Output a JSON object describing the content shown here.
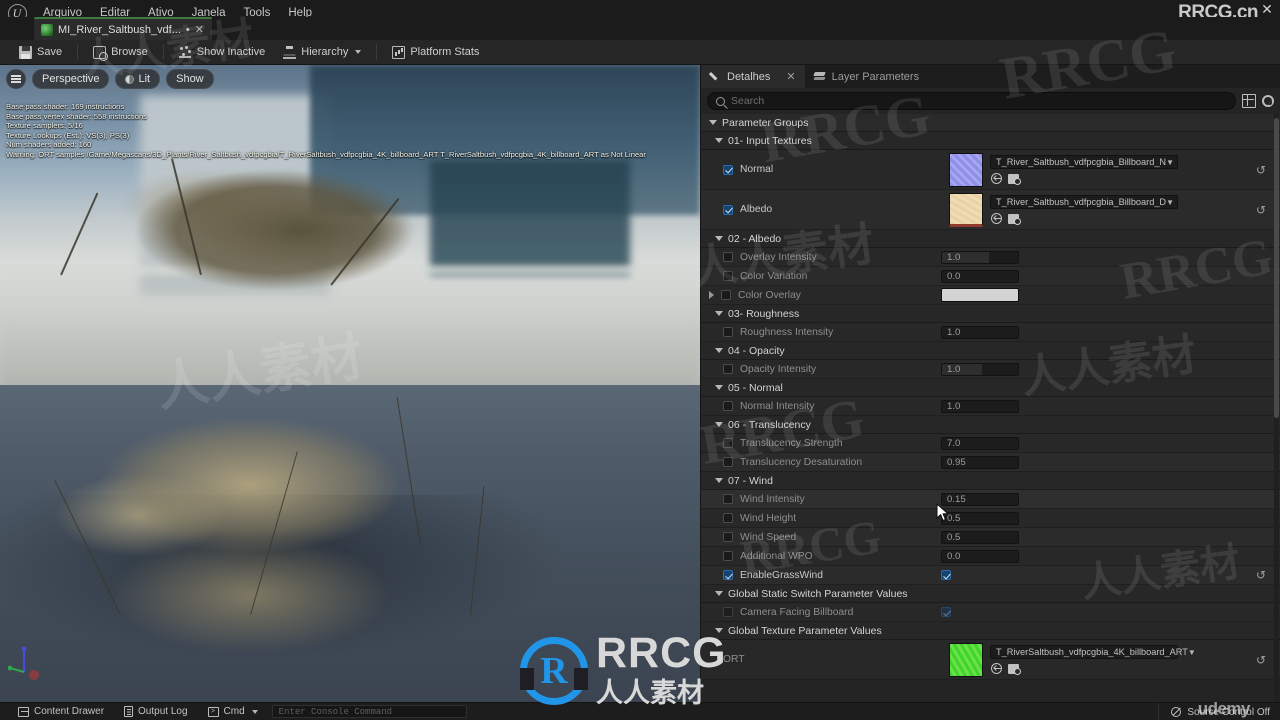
{
  "window": {
    "watermark_right": "RRCG.cn",
    "close_label": "✕"
  },
  "menubar": {
    "items": [
      "Arquivo",
      "Editar",
      "Ativo",
      "Janela",
      "Tools",
      "Help"
    ]
  },
  "tab": {
    "label": "MI_River_Saltbush_vdf...",
    "dirty_marker": "•",
    "close": "✕"
  },
  "toolbar": {
    "save": "Save",
    "browse": "Browse",
    "show_inactive": "Show Inactive",
    "hierarchy": "Hierarchy",
    "platform_stats": "Platform Stats"
  },
  "viewport": {
    "menu_icon": "hamburger-icon",
    "perspective": "Perspective",
    "lit": "Lit",
    "show": "Show",
    "stats": [
      "Base pass shader: 169 instructions",
      "Base pass vertex shader: 558 instructions",
      "Texture samplers: 5/16",
      "Texture Lookups (Est.): VS(3), PS(3)",
      "Num shaders added: 160",
      "Warning: ORT samples /Game/Megascans/3D_Plants/River_Saltbush_vdfpcgbia/T_RiverSaltbush_vdfpcgbia_4K_billboard_ART T_RiverSaltbush_vdfpcgbia_4K_billboard_ART as Not Linear"
    ]
  },
  "details": {
    "tabs": [
      {
        "label": "Detalhes",
        "icon": "pencil-icon",
        "active": true,
        "closable": true
      },
      {
        "label": "Layer Parameters",
        "icon": "layers-icon",
        "active": false,
        "closable": false
      }
    ],
    "search": {
      "placeholder": "Search",
      "value": ""
    },
    "grid_icon": "grid-view-icon",
    "settings_icon": "gear-icon",
    "root_group": "Parameter Groups",
    "groups": [
      {
        "name": "01- Input Textures",
        "type": "texture",
        "rows": [
          {
            "label": "Normal",
            "enabled": true,
            "thumb": "normal-map-thumbnail",
            "asset": "T_River_Saltbush_vdfpcgbia_Billboard_N",
            "revert": true
          },
          {
            "label": "Albedo",
            "enabled": true,
            "thumb": "albedo-map-thumbnail",
            "asset": "T_River_Saltbush_vdfpcgbia_Billboard_D",
            "revert": true
          }
        ]
      },
      {
        "name": "02 - Albedo",
        "type": "scalar",
        "rows": [
          {
            "label": "Overlay Intensity",
            "enabled": false,
            "value": "1.0",
            "fill": 62
          },
          {
            "label": "Color Variation",
            "enabled": false,
            "value": "0.0",
            "fill": 0
          },
          {
            "label": "Color Overlay",
            "enabled": false,
            "value": "",
            "kind": "color",
            "color": "#d3d3d3",
            "expandable": true
          }
        ]
      },
      {
        "name": "03- Roughness",
        "type": "scalar",
        "rows": [
          {
            "label": "Roughness Intensity",
            "enabled": false,
            "value": "1.0",
            "fill": 0
          }
        ]
      },
      {
        "name": "04 - Opacity",
        "type": "scalar",
        "rows": [
          {
            "label": "Opacity Intensity",
            "enabled": false,
            "value": "1.0",
            "fill": 52
          }
        ]
      },
      {
        "name": "05 - Normal",
        "type": "scalar",
        "rows": [
          {
            "label": "Normal Intensity",
            "enabled": false,
            "value": "1.0",
            "fill": 0
          }
        ]
      },
      {
        "name": "06 - Translucency",
        "type": "scalar",
        "rows": [
          {
            "label": "Translucency Strength",
            "enabled": false,
            "value": "7.0",
            "fill": 0
          },
          {
            "label": "Translucency Desaturation",
            "enabled": false,
            "value": "0.95",
            "fill": 0
          }
        ]
      },
      {
        "name": "07 - Wind",
        "type": "scalar",
        "rows": [
          {
            "label": "Wind Intensity",
            "enabled": false,
            "value": "0.15",
            "fill": 0,
            "highlight": true
          },
          {
            "label": "Wind Height",
            "enabled": false,
            "value": "0.5",
            "fill": 0
          },
          {
            "label": "Wind Speed",
            "enabled": false,
            "value": "0.5",
            "fill": 0
          },
          {
            "label": "Additional WPO",
            "enabled": false,
            "value": "0.0",
            "fill": 0
          },
          {
            "label": "EnableGrassWind",
            "enabled": true,
            "kind": "bool",
            "checked": true,
            "revert": true
          }
        ]
      },
      {
        "name": "Global Static Switch Parameter Values",
        "type": "scalar",
        "rows": [
          {
            "label": "Camera Facing Billboard",
            "enabled": false,
            "kind": "bool",
            "checked": true,
            "dim": true
          }
        ]
      },
      {
        "name": "Global Texture Parameter Values",
        "type": "texture",
        "rows": [
          {
            "label": "ORT",
            "enabled": false,
            "thumb": "ort-map-thumbnail",
            "asset": "T_RiverSaltbush_vdfpcgbia_4K_billboard_ART",
            "revert": true
          }
        ]
      }
    ]
  },
  "statusbar": {
    "content_drawer": "Content Drawer",
    "output_log": "Output Log",
    "cmd": "Cmd",
    "console_placeholder": "Enter Console Command",
    "source_control": "Source Control Off"
  },
  "watermarks": {
    "center_logo_text": "RRCG",
    "center_logo_sub": "人人素材",
    "udemy": "udemy",
    "tiles": [
      "RRCG",
      "人人素材",
      "RRCG",
      "人人素材",
      "RRCG"
    ]
  },
  "colors": {
    "accent_blue": "#2196e8",
    "checkbox_blue": "#17436e",
    "panel_bg": "#242424",
    "row_bg": "#282828",
    "tab_green": "#3d7a3d"
  }
}
